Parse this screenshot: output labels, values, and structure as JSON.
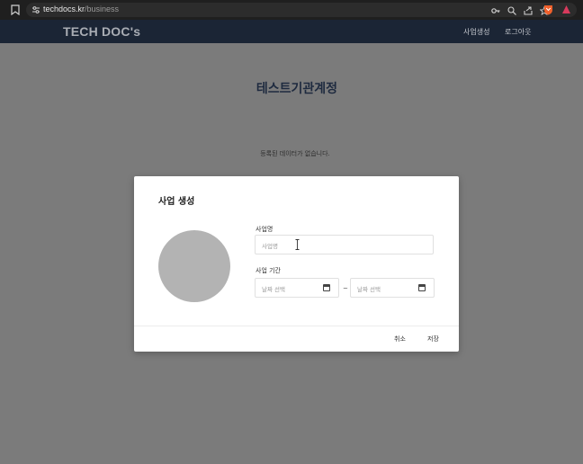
{
  "browser": {
    "url_domain": "techdocs.kr",
    "url_path": "/business",
    "icons": [
      "bookmark-icon",
      "site-settings-icon",
      "key-icon",
      "zoom-icon",
      "share-icon",
      "star-icon",
      "brave-shield-icon",
      "brave-rewards-icon"
    ]
  },
  "header": {
    "logo": "TECH DOC's",
    "nav": [
      "사업생성",
      "로그아웃"
    ]
  },
  "page": {
    "title": "테스트기관계정",
    "empty_message": "등록된 데이터가 없습니다."
  },
  "modal": {
    "title": "사업 생성",
    "name_label": "사업명",
    "name_placeholder": "사업명",
    "period_label": "사업 기간",
    "start_placeholder": "날짜 선택",
    "end_placeholder": "날짜 선택",
    "separator": "~",
    "cancel_label": "취소",
    "save_label": "저장"
  }
}
